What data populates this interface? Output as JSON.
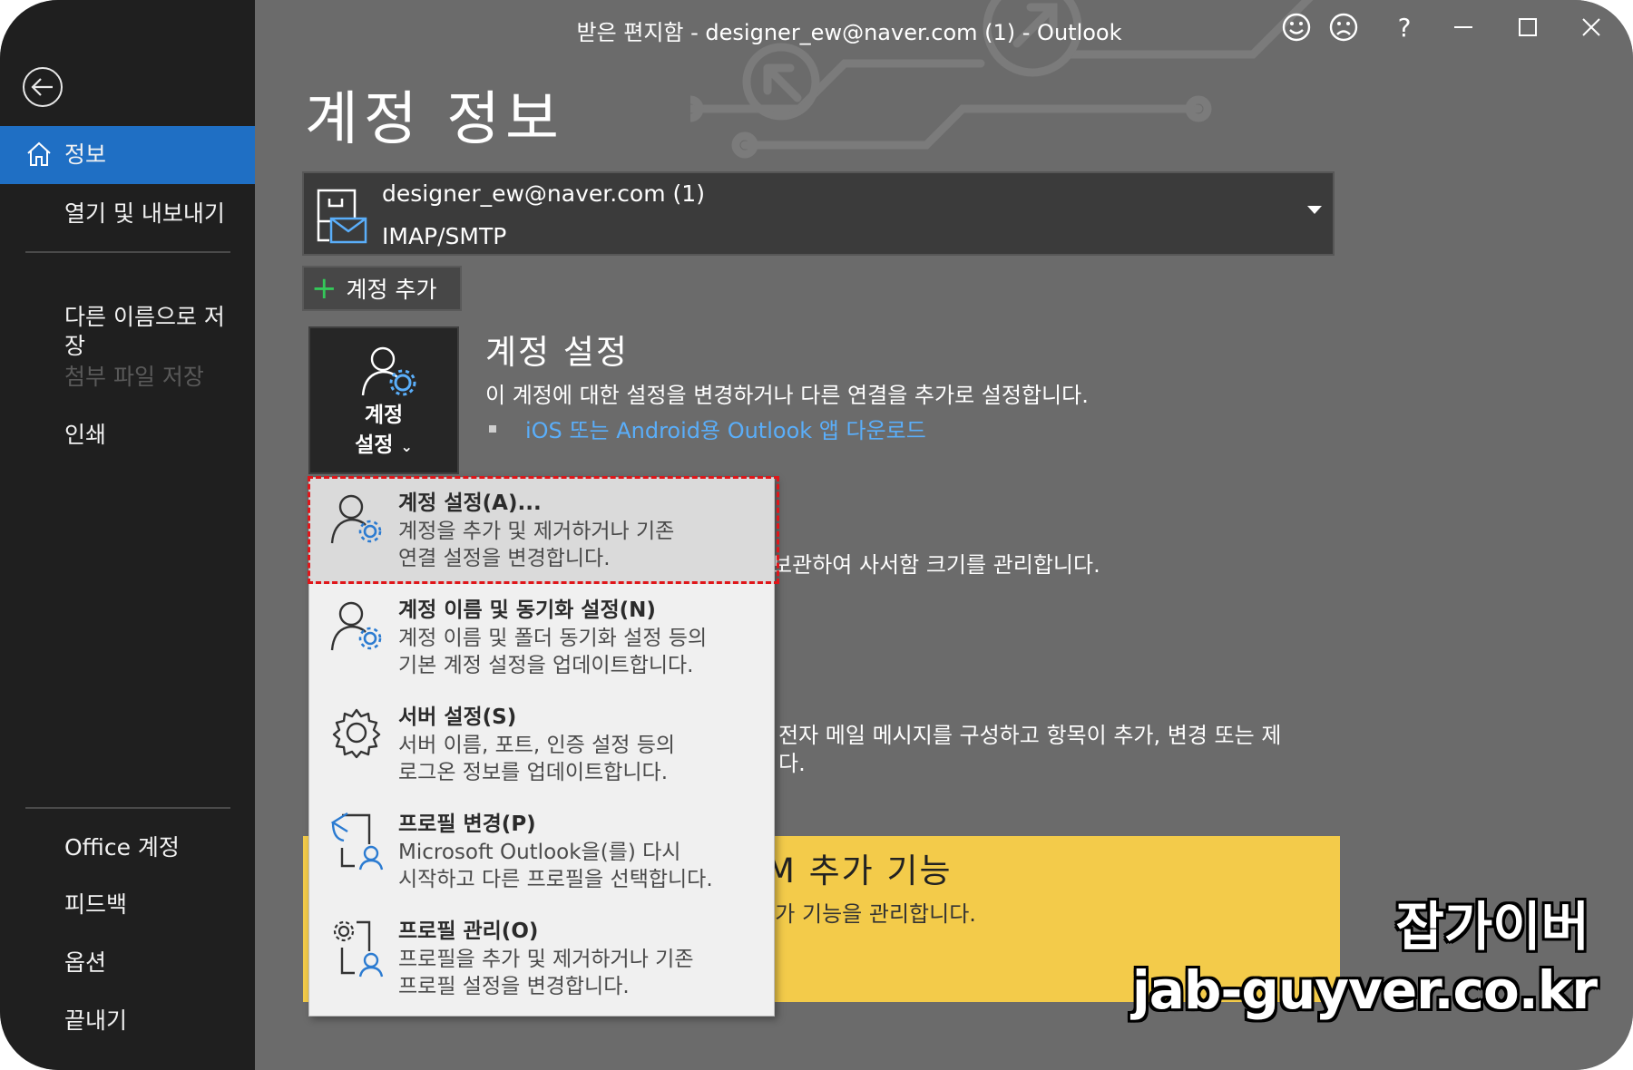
{
  "window": {
    "title": "받은 편지함 - designer_ew@naver.com (1)  -  Outlook"
  },
  "sidebar": {
    "items": [
      {
        "label": "정보",
        "active": true
      },
      {
        "label": "열기 및 내보내기"
      },
      {
        "label": "다른 이름으로 저\n장"
      },
      {
        "label": "첨부 파일 저장",
        "disabled": true
      },
      {
        "label": "인쇄"
      },
      {
        "label": "Office 계정"
      },
      {
        "label": "피드백"
      },
      {
        "label": "옵션"
      },
      {
        "label": "끝내기"
      }
    ]
  },
  "main": {
    "page_title": "계정 정보",
    "account": {
      "email": "designer_ew@naver.com (1)",
      "type": "IMAP/SMTP"
    },
    "add_account_label": "계정 추가",
    "account_settings": {
      "tile_label_1": "계정",
      "tile_label_2": "설정",
      "title": "계정 설정",
      "desc": "이 계정에 대한 설정을 변경하거나 다른 연결을 추가로 설정합니다.",
      "link": "iOS 또는 Android용 Outlook 앱 다운로드"
    },
    "partial_text_1": "보관하여 사서함 크기를 관리합니다.",
    "partial_text_2a": "전자 메일 메시지를 구성하고 항목이 추가, 변경 또는 제",
    "partial_text_2b": "다.",
    "com_addins": {
      "title": "COM 추가 기능",
      "desc": "OM 추가 기능을 관리합니다."
    }
  },
  "dropdown": {
    "items": [
      {
        "title": "계정 설정(A)...",
        "desc1": "계정을 추가 및 제거하거나 기존",
        "desc2": "연결 설정을 변경합니다.",
        "selected": true
      },
      {
        "title": "계정 이름 및 동기화 설정(N)",
        "desc1": "계정 이름 및 폴더 동기화 설정 등의",
        "desc2": "기본 계정 설정을 업데이트합니다."
      },
      {
        "title": "서버 설정(S)",
        "desc1": "서버 이름, 포트, 인증 설정 등의",
        "desc2": "로그온 정보를 업데이트합니다."
      },
      {
        "title": "프로필 변경(P)",
        "desc1": "Microsoft Outlook을(를) 다시",
        "desc2": "시작하고 다른 프로필을 선택합니다."
      },
      {
        "title": "프로필 관리(O)",
        "desc1": "프로필을 추가 및 제거하거나 기존",
        "desc2": "프로필 설정을 변경합니다."
      }
    ]
  },
  "watermark": {
    "line1": "잡가이버",
    "line2": "jab-guyver.co.kr"
  },
  "colors": {
    "sidebar_bg": "#1f1f1f",
    "active_nav": "#1f6fc4",
    "main_bg": "#6b6b6b",
    "link": "#5aaefa",
    "com_panel": "#f3cb4a",
    "highlight_border": "#e0161a"
  }
}
